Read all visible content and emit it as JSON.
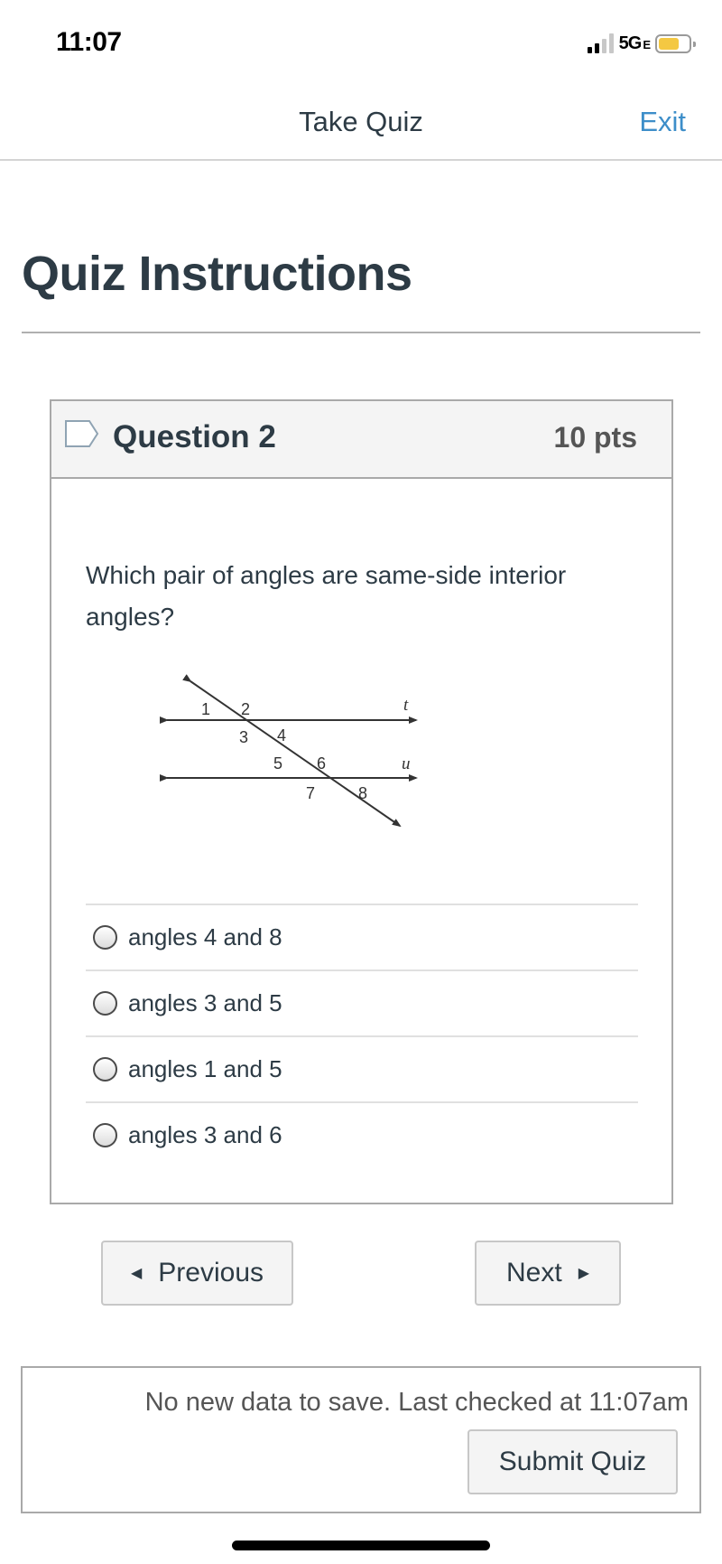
{
  "status_bar": {
    "time": "11:07",
    "network": "5G",
    "network_suffix": "E",
    "signal_bars_filled": 2,
    "signal_bars_total": 4,
    "battery_color": "#f4c842"
  },
  "nav": {
    "title": "Take Quiz",
    "exit_label": "Exit",
    "accent_color": "#3d8ec9"
  },
  "page": {
    "title": "Quiz Instructions"
  },
  "question": {
    "name": "Question 2",
    "points": "10 pts",
    "text": "Which pair of angles are same-side interior angles?",
    "diagram": {
      "line_labels": [
        "t",
        "u"
      ],
      "angle_labels": [
        "1",
        "2",
        "3",
        "4",
        "5",
        "6",
        "7",
        "8"
      ]
    },
    "answers": [
      {
        "label": "angles 4 and 8",
        "selected": false
      },
      {
        "label": "angles 3 and 5",
        "selected": false
      },
      {
        "label": "angles 1 and 5",
        "selected": false
      },
      {
        "label": "angles 3 and 6",
        "selected": false
      }
    ]
  },
  "navigation": {
    "previous_label": "Previous",
    "next_label": "Next"
  },
  "footer": {
    "save_status": "No new data to save. Last checked at 11:07am",
    "submit_label": "Submit Quiz"
  }
}
